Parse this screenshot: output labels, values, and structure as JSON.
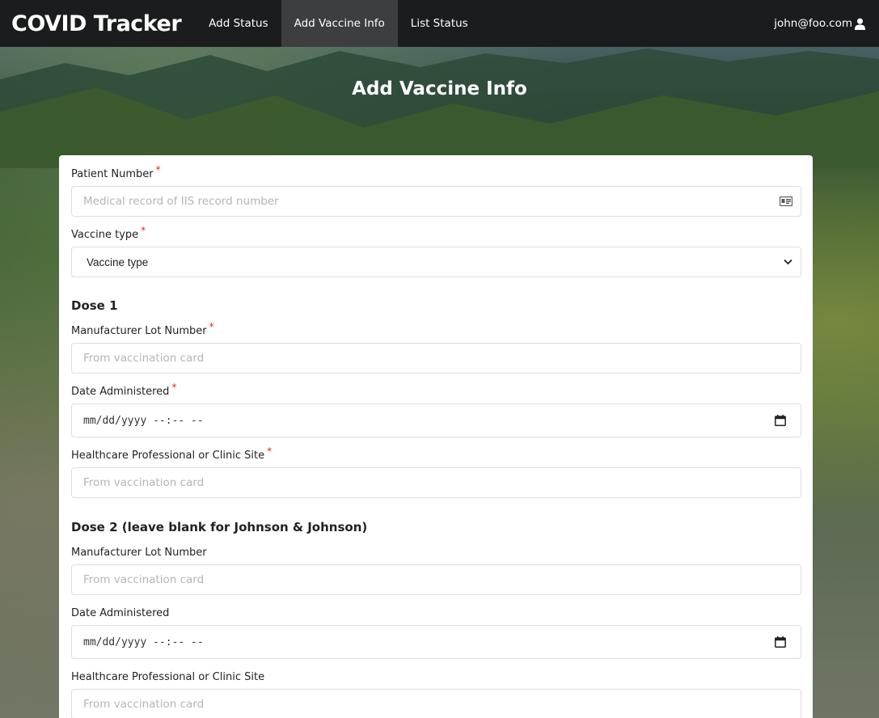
{
  "nav": {
    "brand": "COVID Tracker",
    "items": [
      {
        "label": "Add Status"
      },
      {
        "label": "Add Vaccine Info"
      },
      {
        "label": "List Status"
      }
    ],
    "user": "john@foo.com"
  },
  "page_title": "Add Vaccine Info",
  "form": {
    "required_mark": "*",
    "patient_number": {
      "label": "Patient Number",
      "placeholder": "Medical record of IIS record number"
    },
    "vaccine_type": {
      "label": "Vaccine type",
      "selected": "Vaccine type"
    },
    "dose1": {
      "title": "Dose 1",
      "lot": {
        "label": "Manufacturer Lot Number",
        "placeholder": "From vaccination card"
      },
      "date": {
        "label": "Date Administered",
        "value": "mm/dd/yyyy --:-- --"
      },
      "site": {
        "label": "Healthcare Professional or Clinic Site",
        "placeholder": "From vaccination card"
      }
    },
    "dose2": {
      "title": "Dose 2 (leave blank for Johnson & Johnson)",
      "lot": {
        "label": "Manufacturer Lot Number",
        "placeholder": "From vaccination card"
      },
      "date": {
        "label": "Date Administered",
        "value": "mm/dd/yyyy --:-- --"
      },
      "site": {
        "label": "Healthcare Professional or Clinic Site",
        "placeholder": "From vaccination card"
      }
    }
  }
}
